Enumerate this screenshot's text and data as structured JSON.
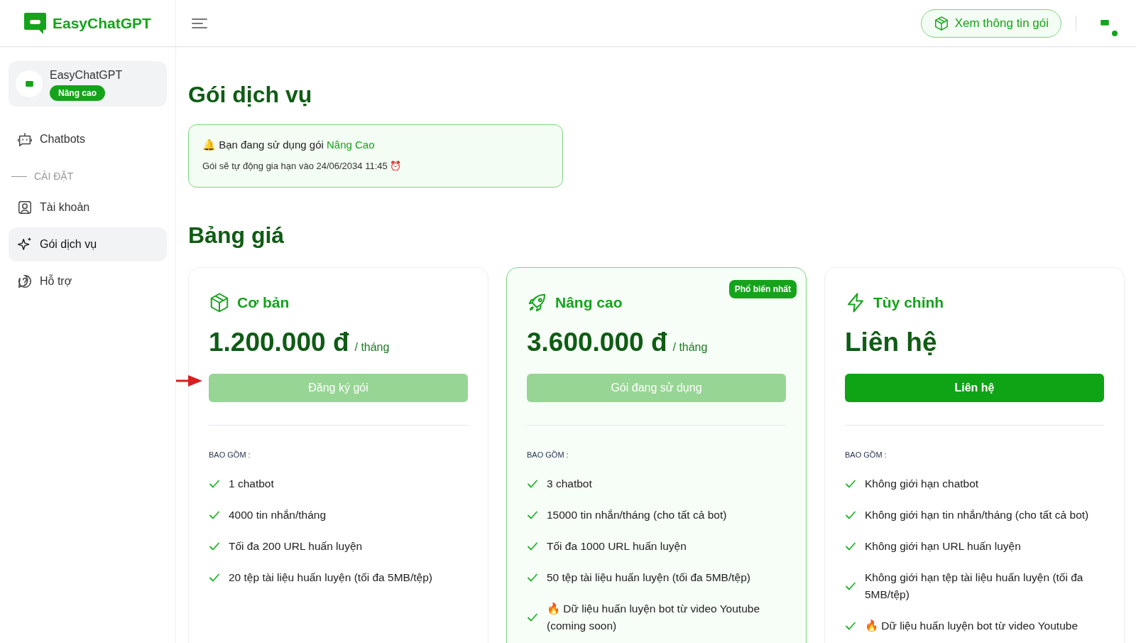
{
  "header": {
    "logo": "EasyChatGPT",
    "package_button": "Xem thông tin gói"
  },
  "sidebar": {
    "profile": {
      "name": "EasyChatGPT",
      "badge": "Nâng cao"
    },
    "items": [
      {
        "label": "Chatbots",
        "selected": false
      },
      {
        "kind": "section",
        "label": "CÀI ĐẶT"
      },
      {
        "label": "Tài khoản",
        "selected": false
      },
      {
        "label": "Gói dịch vụ",
        "selected": true
      },
      {
        "label": "Hỗ trợ",
        "selected": false
      }
    ]
  },
  "page_title": "Gói dịch vụ",
  "notice": {
    "line1": "🔔 Bạn đang sử dụng gói ",
    "plan": "Nâng Cao",
    "line2": "Gói sẽ tự động gia hạn vào 24/06/2034 11:45 ⏰"
  },
  "pricing_title": "Bảng giá",
  "plans": [
    {
      "name": "Cơ bản",
      "highlighted": false,
      "price": "1.200.000 đ",
      "period": "/ tháng",
      "button": "Đăng ký gói",
      "disabled": true,
      "includes": "BAO GỒM :",
      "features": [
        "1 chatbot",
        "4000 tin nhắn/tháng",
        "Tối đa 200 URL huấn luyện",
        "20 tệp tài liệu huấn luyện (tối đa 5MB/tệp)"
      ]
    },
    {
      "name": "Nâng cao",
      "highlighted": true,
      "badge": "Phổ biến nhất",
      "price": "3.600.000 đ",
      "period": "/ tháng",
      "button": "Gói đang sử dụng",
      "disabled": true,
      "includes": "BAO GỒM :",
      "features": [
        "3 chatbot",
        "15000 tin nhắn/tháng (cho tất cả bot)",
        "Tối đa 1000 URL huấn luyện",
        "50 tệp tài liệu huấn luyện (tối đa 5MB/tệp)",
        "🔥 Dữ liệu huấn luyện bot từ video Youtube (coming soon)"
      ]
    },
    {
      "name": "Tùy chỉnh",
      "highlighted": false,
      "price": "Liên hệ",
      "button": "Liên hệ",
      "disabled": false,
      "includes": "BAO GỒM :",
      "features": [
        "Không giới hạn chatbot",
        "Không giới hạn tin nhắn/tháng (cho tất cả bot)",
        "Không giới hạn URL huấn luyện",
        "Không giới hạn tệp tài liệu huấn luyện (tối đa 5MB/tệp)",
        "🔥 Dữ liệu huấn luyện bot từ video Youtube"
      ]
    }
  ]
}
